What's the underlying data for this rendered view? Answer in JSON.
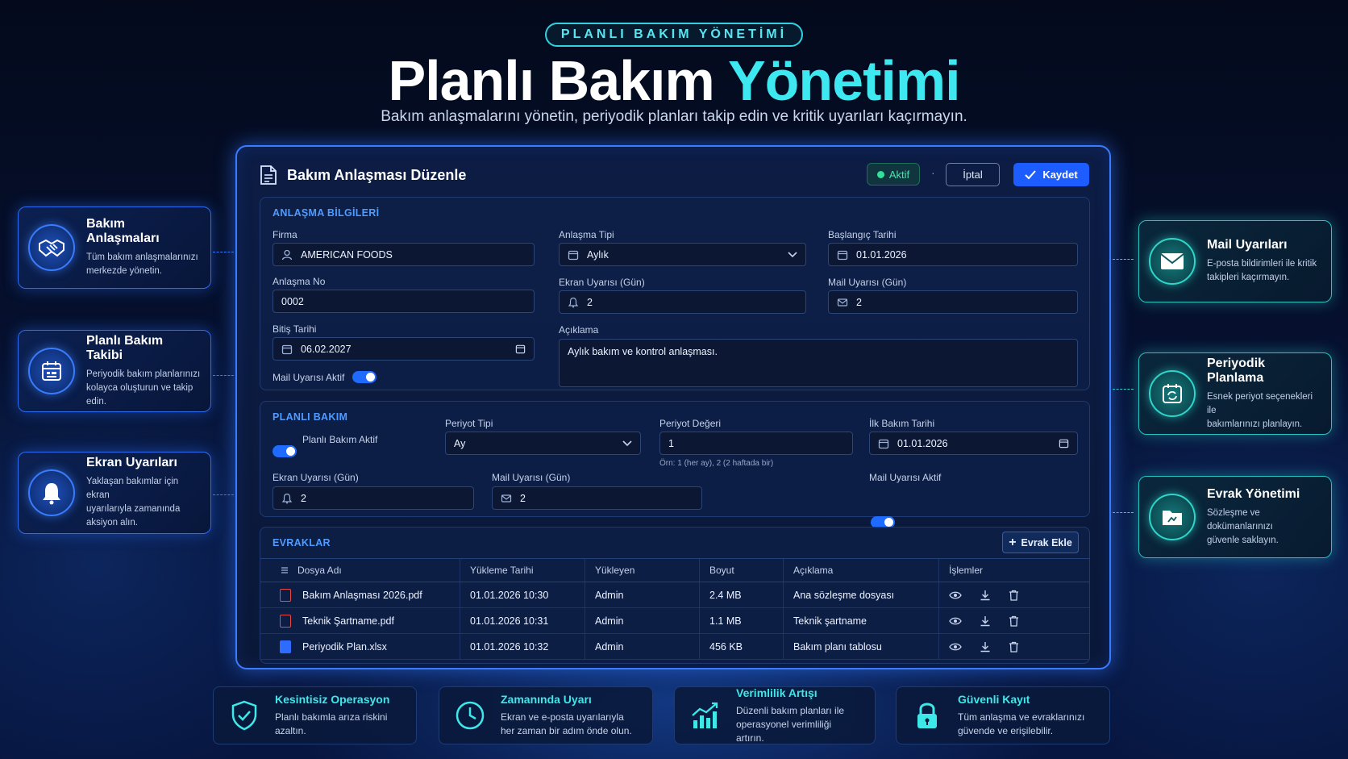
{
  "hero": {
    "pill": "PLANLI BAKIM YÖNETİMİ",
    "title_main": "Planlı Bakım",
    "title_accent": "Yönetimi",
    "subtitle": "Bakım anlaşmalarını yönetin, periyodik planları takip edin ve kritik uyarıları kaçırmayın."
  },
  "left_cards": [
    {
      "title": "Bakım Anlaşmaları",
      "desc1": "Tüm bakım anlaşmalarınızı",
      "desc2": "merkezde yönetin.",
      "icon": "handshake-icon"
    },
    {
      "title": "Planlı Bakım Takibi",
      "desc1": "Periyodik bakım planlarınızı",
      "desc2": "kolayca oluşturun ve takip edin.",
      "icon": "calendar-icon"
    },
    {
      "title": "Ekran Uyarıları",
      "desc1": "Yaklaşan bakımlar için ekran",
      "desc2": "uyarılarıyla zamanında aksiyon alın.",
      "icon": "bell-icon"
    }
  ],
  "right_cards": [
    {
      "title": "Mail Uyarıları",
      "desc1": "E-posta bildirimleri ile kritik",
      "desc2": "takipleri kaçırmayın.",
      "icon": "mail-icon"
    },
    {
      "title": "Periyodik Planlama",
      "desc1": "Esnek periyot seçenekleri ile",
      "desc2": "bakımlarınızı planlayın.",
      "icon": "calendar-refresh-icon"
    },
    {
      "title": "Evrak Yönetimi",
      "desc1": "Sözleşme ve dokümanlarınızı",
      "desc2": "güvenle saklayın.",
      "icon": "folder-icon"
    }
  ],
  "panel": {
    "title": "Bakım Anlaşması Düzenle",
    "status": "Aktif",
    "separator": "·",
    "cancel_label": "İptal",
    "save_label": "Kaydet"
  },
  "agreement": {
    "section_title": "ANLAŞMA BİLGİLERİ",
    "firma_label": "Firma",
    "firma_value": "AMERICAN FOODS",
    "tip_label": "Anlaşma Tipi",
    "tip_value": "Aylık",
    "baslangic_label": "Başlangıç Tarihi",
    "baslangic_value": "01.01.2026",
    "no_label": "Anlaşma No",
    "no_value": "0002",
    "ekran_label": "Ekran Uyarısı (Gün)",
    "ekran_value": "2",
    "mail_label": "Mail Uyarısı (Gün)",
    "mail_value": "2",
    "bitis_label": "Bitiş Tarihi",
    "bitis_value": "06.02.2027",
    "aciklama_label": "Açıklama",
    "aciklama_value": "Aylık bakım ve kontrol anlaşması.",
    "mail_active_label": "Mail Uyarısı Aktif",
    "mail_active": true
  },
  "planned": {
    "section_title": "PLANLI BAKIM",
    "active_label": "Planlı Bakım Aktif",
    "active": true,
    "periyot_tipi_label": "Periyot Tipi",
    "periyot_tipi_value": "Ay",
    "periyot_degeri_label": "Periyot Değeri",
    "periyot_degeri_value": "1",
    "periyot_hint": "Örn: 1 (her ay), 2 (2 haftada bir)",
    "ilk_label": "İlk Bakım Tarihi",
    "ilk_value": "01.01.2026",
    "ekran_label": "Ekran Uyarısı (Gün)",
    "ekran_value": "2",
    "mail_label": "Mail Uyarısı (Gün)",
    "mail_value": "2",
    "mail_active_label": "Mail Uyarısı Aktif",
    "mail_active": true
  },
  "docs": {
    "section_title": "EVRAKLAR",
    "add_label": "Evrak Ekle",
    "columns": [
      "Dosya Adı",
      "Yükleme Tarihi",
      "Yükleyen",
      "Boyut",
      "Açıklama",
      "İşlemler"
    ],
    "rows": [
      {
        "name": "Bakım Anlaşması 2026.pdf",
        "date": "01.01.2026 10:30",
        "user": "Admin",
        "size": "2.4 MB",
        "desc": "Ana sözleşme dosyası",
        "type": "pdf"
      },
      {
        "name": "Teknik Şartname.pdf",
        "date": "01.01.2026 10:31",
        "user": "Admin",
        "size": "1.1 MB",
        "desc": "Teknik şartname",
        "type": "pdf"
      },
      {
        "name": "Periyodik Plan.xlsx",
        "date": "01.01.2026 10:32",
        "user": "Admin",
        "size": "456 KB",
        "desc": "Bakım planı tablosu",
        "type": "xlsx"
      }
    ]
  },
  "bottom_cards": [
    {
      "title": "Kesintisiz Operasyon",
      "desc1": "Planlı bakımla arıza riskini azaltın.",
      "desc2": "",
      "icon": "shield-check-icon"
    },
    {
      "title": "Zamanında Uyarı",
      "desc1": "Ekran ve e-posta uyarılarıyla",
      "desc2": "her zaman bir adım önde olun.",
      "icon": "clock-icon"
    },
    {
      "title": "Verimlilik Artışı",
      "desc1": "Düzenli bakım planları ile",
      "desc2": "operasyonel verimliliği artırın.",
      "icon": "chart-up-icon"
    },
    {
      "title": "Güvenli Kayıt",
      "desc1": "Tüm anlaşma ve evraklarınızı",
      "desc2": "güvende ve erişilebilir.",
      "icon": "lock-icon"
    }
  ],
  "colors": {
    "accent": "#3ee8f0",
    "primary": "#1d5cff",
    "success": "#31e09a",
    "danger": "#e84848"
  }
}
